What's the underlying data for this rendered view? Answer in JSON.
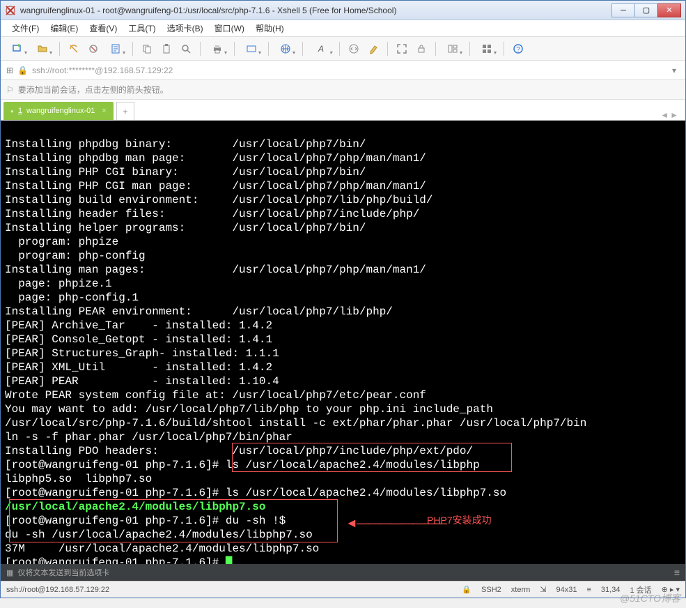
{
  "window": {
    "title": "wangruifenglinux-01 - root@wangruifeng-01:/usr/local/src/php-7.1.6 - Xshell 5 (Free for Home/School)"
  },
  "menu": {
    "file": "文件(F)",
    "edit": "编辑(E)",
    "view": "查看(V)",
    "tools": "工具(T)",
    "tabs": "选项卡(B)",
    "window": "窗口(W)",
    "help": "帮助(H)"
  },
  "address": {
    "text": "ssh://root:********@192.168.57.129:22"
  },
  "hint": {
    "text": "要添加当前会话，点击左侧的箭头按钮。"
  },
  "tab": {
    "index": "1",
    "label": "wangruifenglinux-01",
    "add": "+"
  },
  "terminal": {
    "lines": [
      "Installing phpdbg binary:         /usr/local/php7/bin/",
      "Installing phpdbg man page:       /usr/local/php7/php/man/man1/",
      "Installing PHP CGI binary:        /usr/local/php7/bin/",
      "Installing PHP CGI man page:      /usr/local/php7/php/man/man1/",
      "Installing build environment:     /usr/local/php7/lib/php/build/",
      "Installing header files:          /usr/local/php7/include/php/",
      "Installing helper programs:       /usr/local/php7/bin/",
      "  program: phpize",
      "  program: php-config",
      "Installing man pages:             /usr/local/php7/php/man/man1/",
      "  page: phpize.1",
      "  page: php-config.1",
      "Installing PEAR environment:      /usr/local/php7/lib/php/",
      "[PEAR] Archive_Tar    - installed: 1.4.2",
      "[PEAR] Console_Getopt - installed: 1.4.1",
      "[PEAR] Structures_Graph- installed: 1.1.1",
      "[PEAR] XML_Util       - installed: 1.4.2",
      "[PEAR] PEAR           - installed: 1.10.4",
      "Wrote PEAR system config file at: /usr/local/php7/etc/pear.conf",
      "You may want to add: /usr/local/php7/lib/php to your php.ini include_path",
      "/usr/local/src/php-7.1.6/build/shtool install -c ext/phar/phar.phar /usr/local/php7/bin",
      "ln -s -f phar.phar /usr/local/php7/bin/phar",
      "Installing PDO headers:           /usr/local/php7/include/php/ext/pdo/"
    ],
    "prompt1_a": "[root@wangruifeng-01 php-7.1.6]# ",
    "prompt1_b": "ls /usr/local/apache2.4/modules/libphp",
    "lsout": "libphp5.so  libphp7.so",
    "prompt2_a": "[root@wangruifeng-01 php-7.1.6]# ",
    "prompt2_b": "ls /usr/local/apache2.4/modules/libphp7.so",
    "green_path": "/usr/local/apache2.4/modules/libphp7.so",
    "prompt3_a": "[root@wangruifeng-01 php-7.1.6]# ",
    "prompt3_b": "du -sh !$",
    "du_echo": "du -sh /usr/local/apache2.4/modules/libphp7.so",
    "du_out": "37M     /usr/local/apache2.4/modules/libphp7.so",
    "prompt4": "[root@wangruifeng-01 php-7.1.6]# ",
    "annotation_arrow": "◄————————",
    "annotation_label": "PHP7安装成功"
  },
  "sendbar": {
    "text": "仅将文本发送到当前选项卡"
  },
  "status": {
    "conn": "ssh://root@192.168.57.129:22",
    "proto": "SSH2",
    "term": "xterm",
    "size": "94x31",
    "pos": "31,34",
    "sess": "1 会话"
  },
  "watermark": "@51CTO博客"
}
